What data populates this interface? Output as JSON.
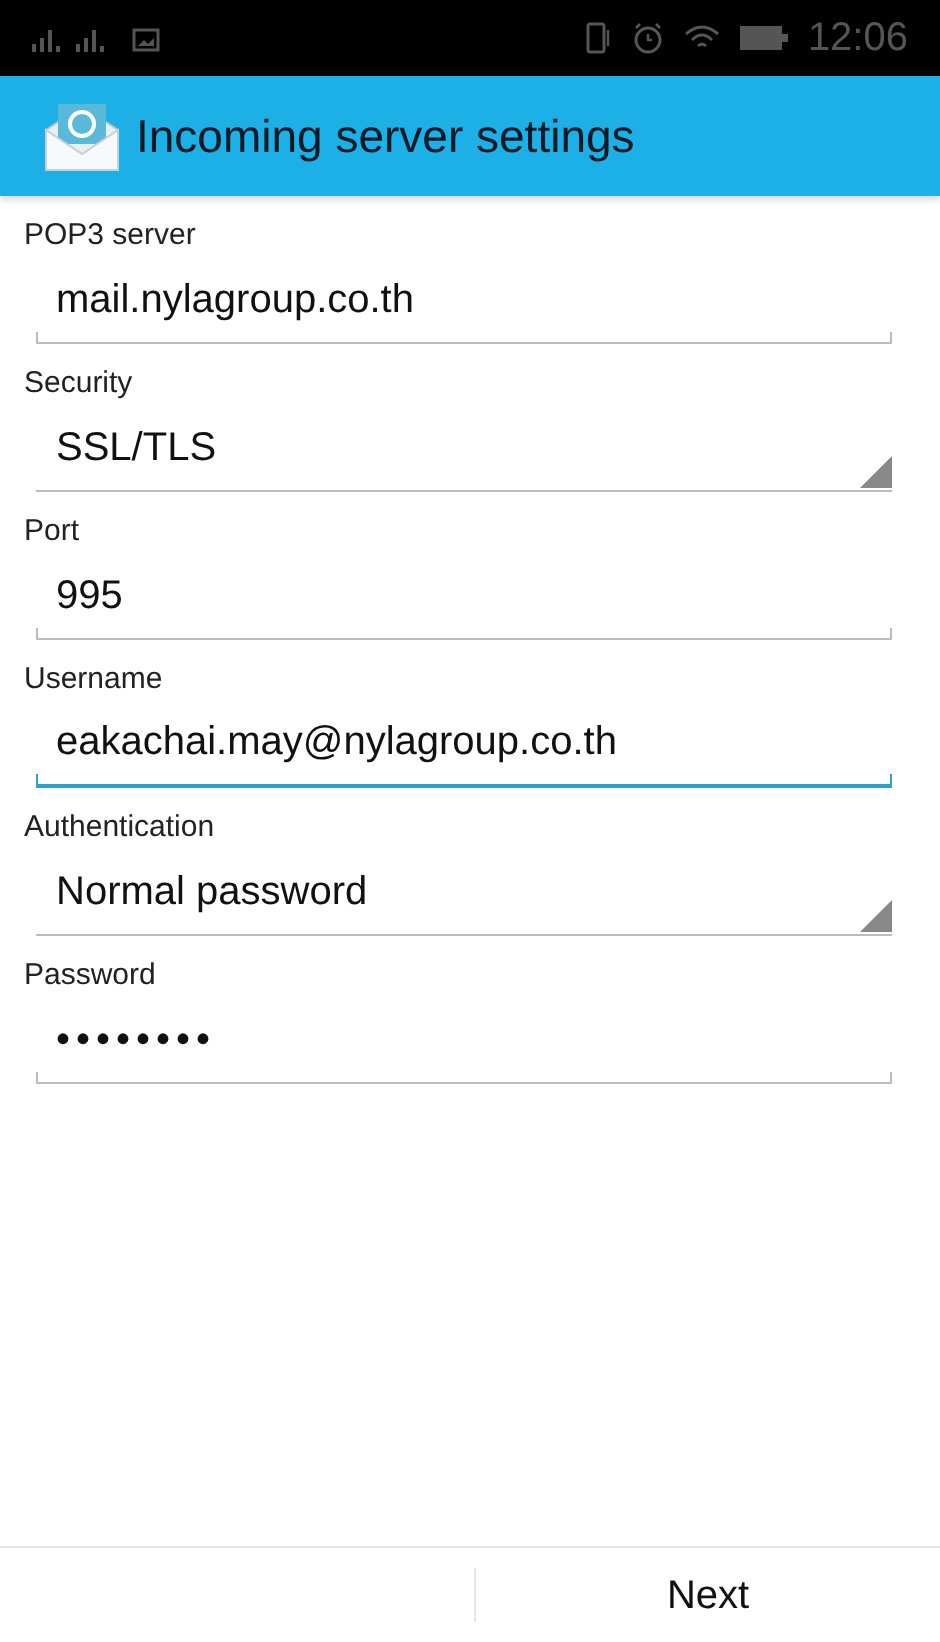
{
  "status_bar": {
    "time": "12:06"
  },
  "app_bar": {
    "title": "Incoming server settings"
  },
  "fields": [
    {
      "label": "POP3 server",
      "kind": "text",
      "value": "mail.nylagroup.co.th",
      "focused": false
    },
    {
      "label": "Security",
      "kind": "select",
      "value": "SSL/TLS",
      "focused": false
    },
    {
      "label": "Port",
      "kind": "text",
      "value": "995",
      "focused": false
    },
    {
      "label": "Username",
      "kind": "text",
      "value": "eakachai.may@nylagroup.co.th",
      "focused": true
    },
    {
      "label": "Authentication",
      "kind": "select",
      "value": "Normal password",
      "focused": false
    },
    {
      "label": "Password",
      "kind": "password",
      "value": "••••••••",
      "focused": false
    }
  ],
  "buttons": [
    "Next"
  ]
}
